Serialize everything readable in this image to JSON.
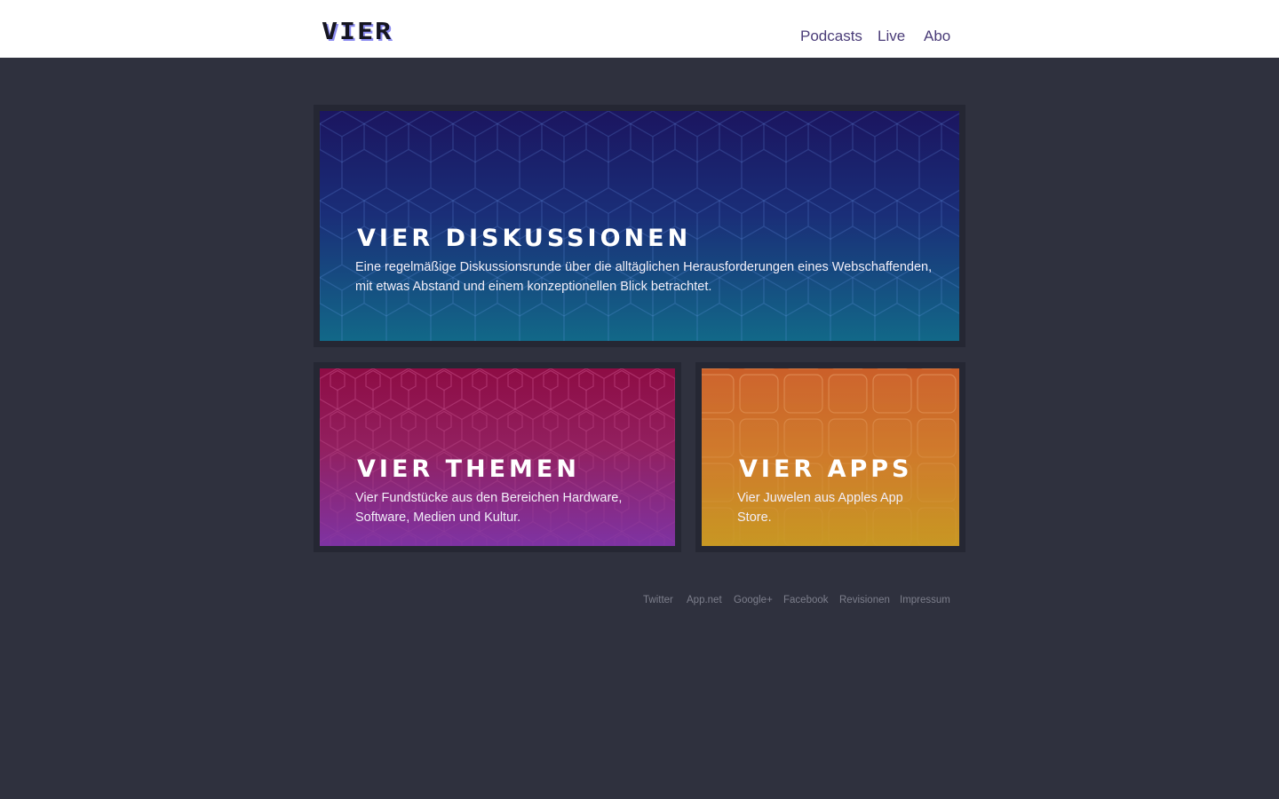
{
  "header": {
    "logo_text": "VIER",
    "nav": [
      {
        "label": "Podcasts"
      },
      {
        "label": "Live"
      },
      {
        "label": "Abo"
      }
    ]
  },
  "cards": {
    "diskussionen": {
      "title": "VIER DISKUSSIONEN",
      "description_line1": "Eine regelmäßige Diskussionsrunde über die alltäglichen Herausforderungen eines Webschaffenden,",
      "description_line2": "mit etwas Abstand und einem konzeptionellen Blick betrachtet."
    },
    "themen": {
      "title": "VIER THEMEN",
      "description_line1": "Vier Fundstücke aus den Bereichen Hardware,",
      "description_line2": "Software, Medien und Kultur."
    },
    "apps": {
      "title": "VIER APPS",
      "description_line1": "Vier Juwelen aus Apples App",
      "description_line2": "Store."
    }
  },
  "footer": {
    "links": [
      {
        "label": "Twitter"
      },
      {
        "label": "App.net"
      },
      {
        "label": "Google+"
      },
      {
        "label": "Facebook"
      },
      {
        "label": "Revisionen"
      },
      {
        "label": "Impressum"
      }
    ]
  },
  "colors": {
    "page_background": "#2f313e",
    "header_background": "#ffffff",
    "nav_text": "#4a3c78",
    "diskussionen_gradient": [
      "#1b1560",
      "#126888"
    ],
    "themen_gradient": [
      "#8e0c44",
      "#7e33a3"
    ],
    "apps_gradient": [
      "#cb5f29",
      "#c89823"
    ]
  }
}
